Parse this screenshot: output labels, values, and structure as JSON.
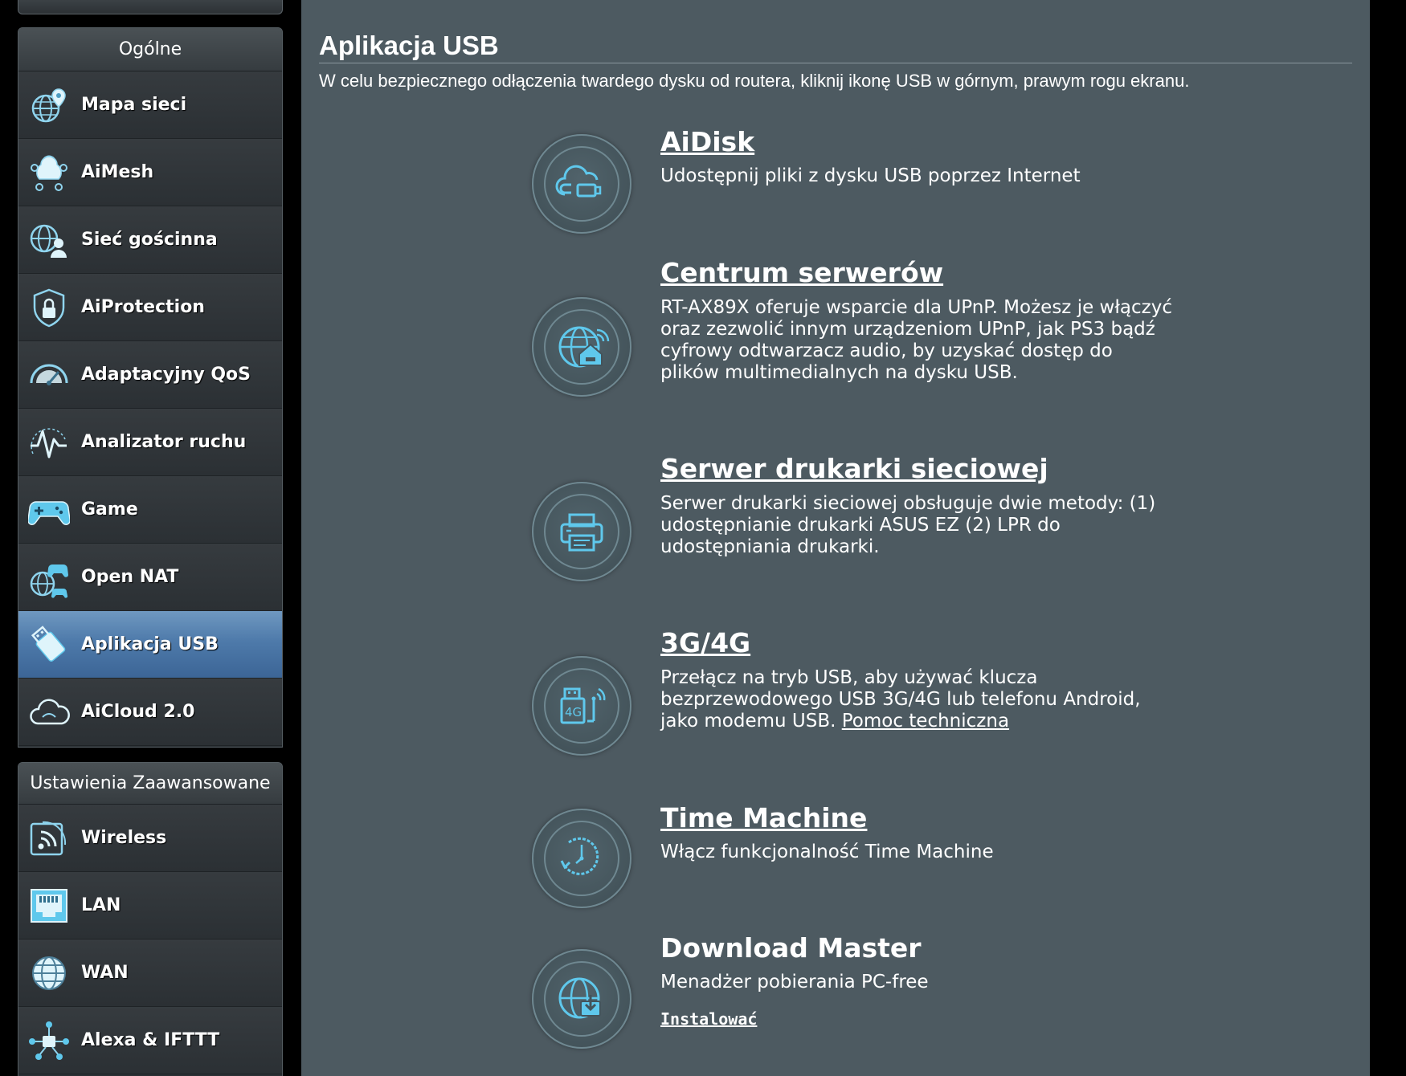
{
  "sidebar": {
    "general_header": "Ogólne",
    "general_items": [
      {
        "label": "Mapa sieci",
        "icon": "network-map-icon"
      },
      {
        "label": "AiMesh",
        "icon": "aimesh-icon"
      },
      {
        "label": "Sieć gościnna",
        "icon": "guest-network-icon"
      },
      {
        "label": "AiProtection",
        "icon": "aiprotection-icon"
      },
      {
        "label": "Adaptacyjny QoS",
        "icon": "qos-gauge-icon"
      },
      {
        "label": "Analizator ruchu",
        "icon": "traffic-analyzer-icon"
      },
      {
        "label": "Game",
        "icon": "gamepad-icon"
      },
      {
        "label": "Open NAT",
        "icon": "open-nat-icon"
      },
      {
        "label": "Aplikacja USB",
        "icon": "usb-app-icon",
        "active": true
      },
      {
        "label": "AiCloud 2.0",
        "icon": "aicloud-icon"
      }
    ],
    "advanced_header": "Ustawienia Zaawansowane",
    "advanced_items": [
      {
        "label": "Wireless",
        "icon": "wireless-icon"
      },
      {
        "label": "LAN",
        "icon": "lan-icon"
      },
      {
        "label": "WAN",
        "icon": "wan-globe-icon"
      },
      {
        "label": "Alexa & IFTTT",
        "icon": "alexa-ifttt-icon"
      }
    ]
  },
  "main": {
    "title": "Aplikacja USB",
    "description": "W celu bezpiecznego odłączenia twardego dysku od routera, kliknij ikonę USB w górnym, prawym rogu ekranu.",
    "apps": [
      {
        "title": "AiDisk",
        "icon": "aidisk-cloud-icon",
        "description": "Udostępnij pliki z dysku USB poprzez Internet"
      },
      {
        "title": "Centrum serwerów",
        "icon": "server-center-icon",
        "description": "RT-AX89X oferuje wsparcie dla UPnP. Możesz je włączyć oraz zezwolić innym urządzeniom UPnP, jak PS3 bądź cyfrowy odtwarzacz audio, by uzyskać dostęp do plików multimedialnych na dysku USB."
      },
      {
        "title": "Serwer drukarki sieciowej",
        "icon": "printer-icon",
        "description": "Serwer drukarki sieciowej obsługuje dwie metody: (1) udostępnianie drukarki ASUS EZ (2) LPR do udostępniania drukarki."
      },
      {
        "title": "3G/4G",
        "icon": "modem-4g-icon",
        "description": "Przełącz na tryb USB, aby używać klucza bezprzewodowego USB 3G/4G lub telefonu Android, jako modemu USB.",
        "link": "Pomoc techniczna"
      },
      {
        "title": "Time Machine",
        "icon": "time-machine-clock-icon",
        "description": "Włącz funkcjonalność Time Machine"
      },
      {
        "title": "Download Master",
        "icon": "download-master-icon",
        "description": "Menadżer pobierania PC-free",
        "install": "Instalować"
      }
    ]
  },
  "colors": {
    "main_bg": "#4d5a61",
    "sidebar_bg": "#2b3034",
    "active_item": "#4e7aaa",
    "icon_accent": "#5fc8ec"
  }
}
